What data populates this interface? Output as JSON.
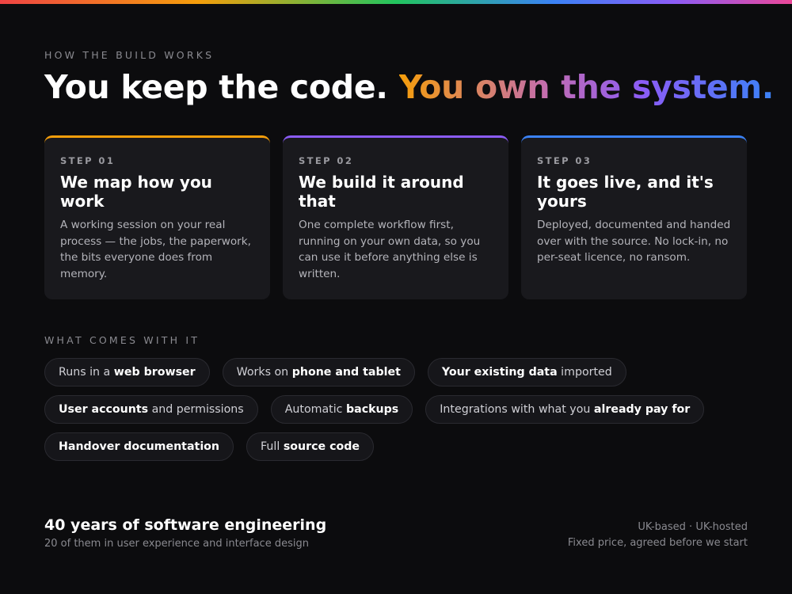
{
  "hero": {
    "eyebrow": "HOW THE BUILD WORKS",
    "headline_plain": "You keep the code. ",
    "headline_accent": "You own the system."
  },
  "steps": [
    {
      "step": "STEP 01",
      "title": "We map how you work",
      "body": "A working session on your real process — the jobs, the paperwork, the bits everyone does from memory."
    },
    {
      "step": "STEP 02",
      "title": "We build it around that",
      "body": "One complete workflow first, running on your own data, so you can use it before anything else is written."
    },
    {
      "step": "STEP 03",
      "title": "It goes live, and it's yours",
      "body": "Deployed, documented and handed over with the source. No lock-in, no per-seat licence, no ransom."
    }
  ],
  "included": {
    "eyebrow": "WHAT COMES WITH IT",
    "chips": [
      {
        "pre": "Runs in a ",
        "bold": "web browser",
        "post": ""
      },
      {
        "pre": "Works on ",
        "bold": "phone and tablet",
        "post": ""
      },
      {
        "pre": "",
        "bold": "Your existing data",
        "post": " imported"
      },
      {
        "pre": "",
        "bold": "User accounts",
        "post": " and permissions"
      },
      {
        "pre": "Automatic ",
        "bold": "backups",
        "post": ""
      },
      {
        "pre": "Integrations with what you ",
        "bold": "already pay for",
        "post": ""
      },
      {
        "pre": "",
        "bold": "Handover documentation",
        "post": ""
      },
      {
        "pre": "Full ",
        "bold": "source code",
        "post": ""
      }
    ]
  },
  "footer": {
    "title": "40 years of software engineering",
    "subtitle": "20 of them in user experience and interface design",
    "right_line_1": "UK-based · UK-hosted",
    "right_line_2": "Fixed price, agreed before we start"
  },
  "colors": {
    "background": "#0c0c0e",
    "card": "#19191d",
    "step1_accent": "#f59e0b",
    "step2_accent": "#8b5cf6",
    "step3_accent": "#3b82f6"
  }
}
